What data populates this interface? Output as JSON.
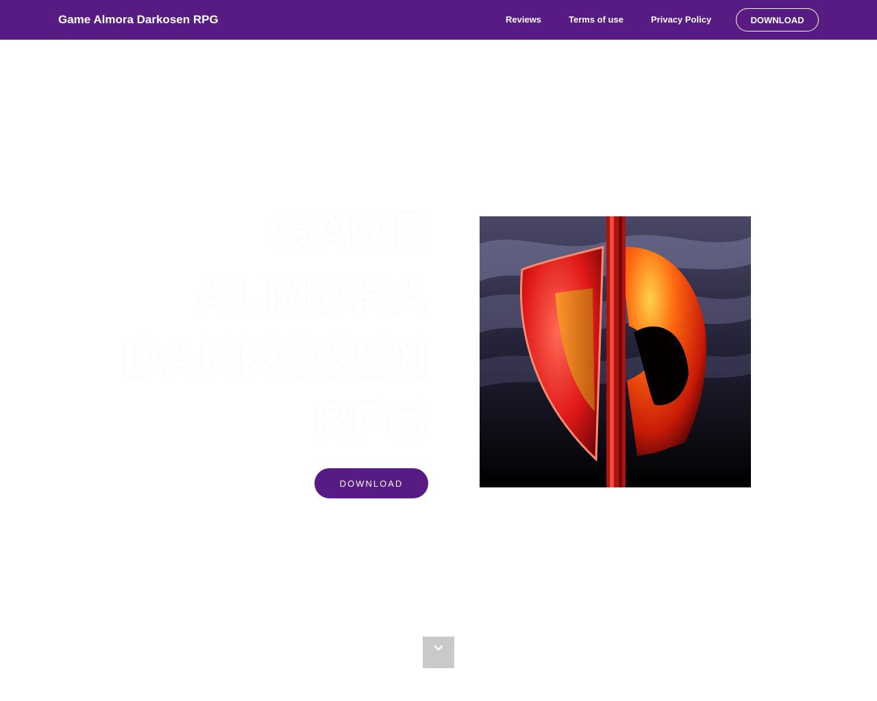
{
  "navbar": {
    "brand": "Game Almora Darkosen RPG",
    "links": [
      "Reviews",
      "Terms of use",
      "Privacy Policy"
    ],
    "download_label": "DOWNLOAD",
    "background_color": "#581b84"
  },
  "hero": {
    "title": "GAME ALMORA DARKOSEN RPG",
    "download_label": "DOWNLOAD",
    "image_icon": "shield-helmet-game-icon"
  },
  "scroll": {
    "icon": "chevron-down-icon"
  }
}
